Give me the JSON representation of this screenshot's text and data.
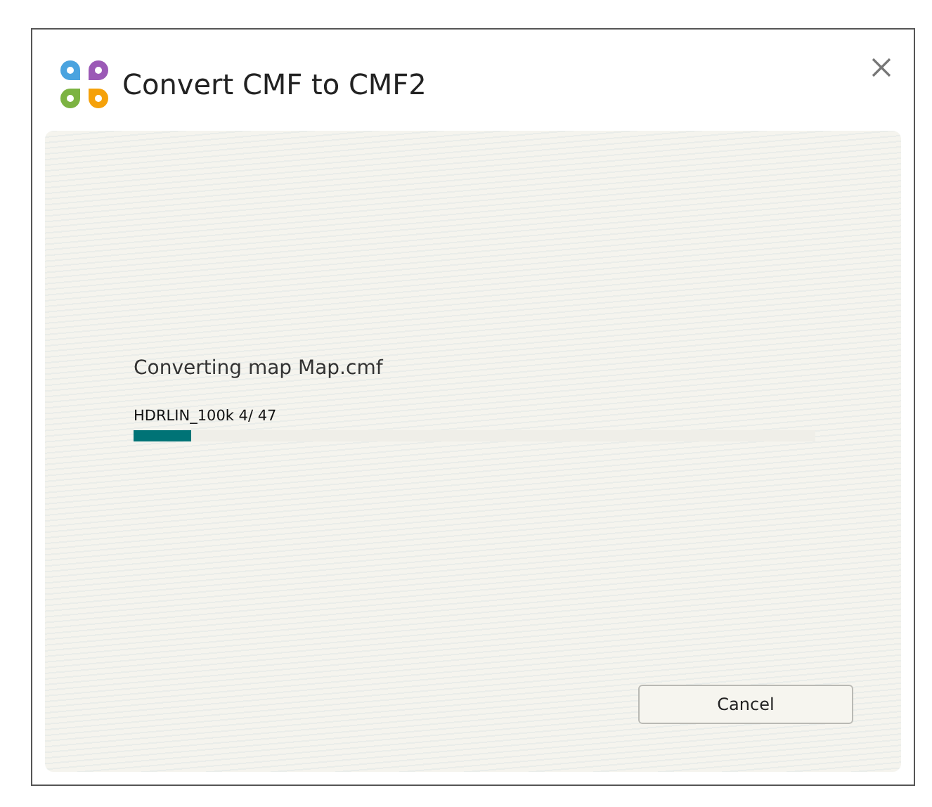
{
  "window": {
    "title": "Convert CMF to CMF2"
  },
  "status": {
    "message": "Converting map Map.cmf",
    "item": "HDRLIN_100k 4/ 47",
    "level": 0.085
  },
  "buttons": [
    "Cancel"
  ]
}
